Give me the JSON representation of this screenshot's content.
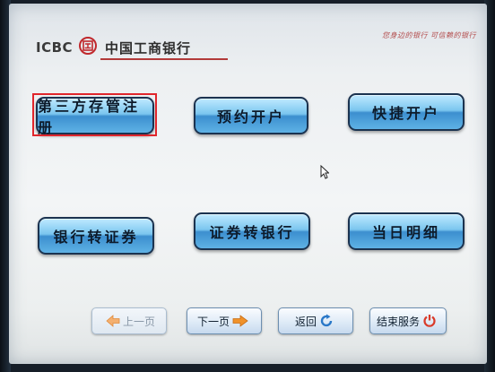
{
  "header": {
    "logo_text": "ICBC",
    "seal_glyph": "工",
    "bank_name": "中国工商银行",
    "slogan": "您身边的银行 可信赖的银行"
  },
  "menu": {
    "items": [
      {
        "label": "第三方存管注册",
        "highlighted": true
      },
      {
        "label": "预约开户"
      },
      {
        "label": "快捷开户"
      },
      {
        "label": "银行转证券"
      },
      {
        "label": "证券转银行"
      },
      {
        "label": "当日明细"
      }
    ]
  },
  "nav": {
    "prev_label": "上一页",
    "next_label": "下一页",
    "back_label": "返回",
    "exit_label": "结束服务"
  },
  "colors": {
    "accent_red": "#e0262c",
    "button_blue": "#3c8fcf",
    "arrow_orange": "#f0922a",
    "refresh_blue": "#2a78c8",
    "power_red": "#d93a2a"
  },
  "icons": {
    "prev": "left-arrow-icon",
    "next": "right-arrow-icon",
    "back": "refresh-icon",
    "exit": "power-icon",
    "cursor": "mouse-cursor-icon"
  }
}
